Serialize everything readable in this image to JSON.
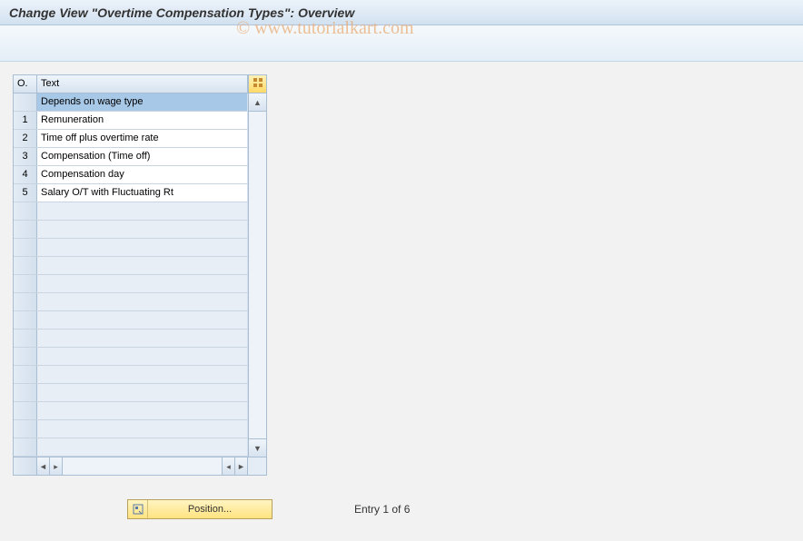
{
  "header": {
    "title": "Change View \"Overtime Compensation Types\": Overview"
  },
  "watermark": "© www.tutorialkart.com",
  "table": {
    "columns": {
      "o": "O.",
      "text": "Text"
    },
    "rows": [
      {
        "o": "",
        "text": "Depends on wage type",
        "selected": true
      },
      {
        "o": "1",
        "text": "Remuneration",
        "selected": false
      },
      {
        "o": "2",
        "text": "Time off plus overtime rate",
        "selected": false
      },
      {
        "o": "3",
        "text": "Compensation (Time off)",
        "selected": false
      },
      {
        "o": "4",
        "text": "Compensation day",
        "selected": false
      },
      {
        "o": "5",
        "text": "Salary O/T with Fluctuating Rt",
        "selected": false
      }
    ],
    "empty_rows": 14
  },
  "footer": {
    "position_button": "Position...",
    "entry_status": "Entry 1 of 6"
  }
}
